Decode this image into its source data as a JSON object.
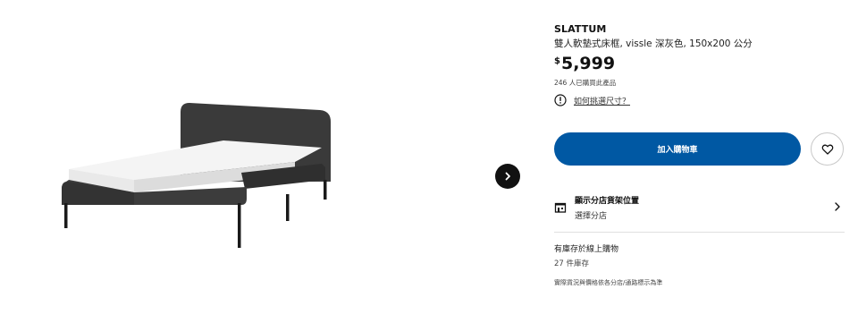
{
  "product": {
    "name": "SLATTUM",
    "description": "雙人軟墊式床框, vissle 深灰色, 150x200 公分",
    "price_currency": "$",
    "price": "5,999",
    "sold_count": "246 人已購買此產品",
    "size_guide_link": "如何挑選尺寸？"
  },
  "actions": {
    "add_to_cart": "加入購物車"
  },
  "store": {
    "title": "顯示分店貨架位置",
    "subtitle": "選擇分店"
  },
  "stock": {
    "online": "有庫存於線上購物",
    "count": "27 件庫存",
    "note": "實際貨況與價格依各分店/通路標示為準"
  },
  "icons": {
    "next": "chevron-right-icon",
    "info": "info-icon",
    "favorite": "heart-icon",
    "store": "store-icon",
    "chevron": "chevron-right-icon"
  },
  "colors": {
    "primary": "#0058a3",
    "bed_fabric": "#3a3a3a",
    "mattress": "#f4f4f4"
  }
}
